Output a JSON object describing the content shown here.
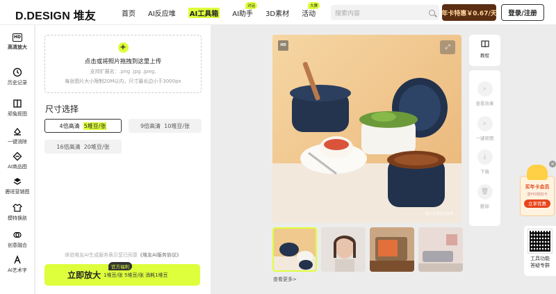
{
  "header": {
    "logo": "D.DESIGN 堆友",
    "nav": [
      {
        "label": "首页",
        "badge": ""
      },
      {
        "label": "AI反应堆",
        "badge": ""
      },
      {
        "label": "AI工具箱",
        "badge": "",
        "active": true
      },
      {
        "label": "AI助手",
        "badge": "对话"
      },
      {
        "label": "3D素材",
        "badge": ""
      },
      {
        "label": "活动",
        "badge": "大赛"
      }
    ],
    "search_placeholder": "搜索内容",
    "promo": "年卡特惠￥0.67/天",
    "login": "登录/注册"
  },
  "sidebar": {
    "items": [
      {
        "label": "高清放大",
        "icon": "hd-icon"
      },
      {
        "label": "历史记录",
        "icon": "clock-icon"
      },
      {
        "label": "顽兔抠图",
        "icon": "cutout-icon"
      },
      {
        "label": "一键消除",
        "icon": "eraser-icon"
      },
      {
        "label": "AI商品图",
        "icon": "product-icon"
      },
      {
        "label": "鹿班营销图",
        "icon": "layers-icon"
      },
      {
        "label": "模特换肤",
        "icon": "shirt-icon"
      },
      {
        "label": "创意融合",
        "icon": "blend-icon"
      },
      {
        "label": "AI艺术字",
        "icon": "text-icon"
      }
    ]
  },
  "panel": {
    "upload_title": "点击或将照片拖拽到这里上传",
    "upload_formats": "支持扩展名：.png .jpg .jpeg,",
    "upload_limit": "每张图片大小限制20M以内，尺寸最长边小于3000px",
    "size_title": "尺寸选择",
    "options": [
      {
        "label": "4倍高清",
        "cost": "5堆豆/张",
        "selected": true
      },
      {
        "label": "9倍高清",
        "cost": "10堆豆/张",
        "selected": false
      },
      {
        "label": "16倍高清",
        "cost": "20堆豆/张",
        "selected": false
      }
    ],
    "agreement_prefix": "体验堆友AI生成服务表示您已同意",
    "agreement_link": "《堆友AI服务协议》",
    "cta_label": "立即放大",
    "cta_tag": "官方福利",
    "cta_sub": "1堆豆/张 5堆豆/张 消耗1堆豆"
  },
  "canvas": {
    "hd_badge": "HD",
    "watermark": "图片生成自AI效果",
    "see_more": "查看更多>"
  },
  "right_tools": [
    {
      "label": "教程",
      "icon": "book-icon",
      "enabled": true
    },
    {
      "label": "查看效果",
      "icon": "magnifier-icon",
      "enabled": false
    },
    {
      "label": "一键抠图",
      "icon": "magnifier-icon",
      "enabled": false
    },
    {
      "label": "下载",
      "icon": "download-icon",
      "enabled": false
    },
    {
      "label": "删除",
      "icon": "trash-icon",
      "enabled": false
    }
  ],
  "float_promo": {
    "title": "买年卡会员",
    "sub": "送¥50抵扣卡",
    "button": "立享优惠"
  },
  "qr_card": {
    "line1": "工具功能",
    "line2": "答疑专群"
  },
  "colors": {
    "accent": "#ddff3c",
    "promo_bg": "#5a2e12",
    "promo_text": "#ffd7a0"
  }
}
